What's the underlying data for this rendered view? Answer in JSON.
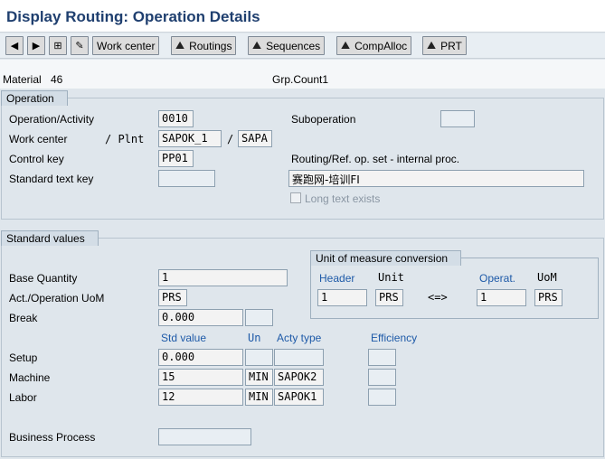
{
  "title": "Display Routing: Operation Details",
  "toolbar": {
    "work_center": "Work center",
    "routings": "Routings",
    "sequences": "Sequences",
    "compalloc": "CompAlloc",
    "prt": "PRT"
  },
  "header": {
    "material_label": "Material",
    "material_value": "46",
    "grpcount_label": "Grp.Count1"
  },
  "operation": {
    "section_title": "Operation",
    "op_activity_label": "Operation/Activity",
    "op_activity_value": "0010",
    "suboperation_label": "Suboperation",
    "suboperation_value": "",
    "work_center_label": "Work center",
    "plnt_label": "/ Plnt",
    "work_center_value": "SAPOK_1",
    "slash": "/",
    "plant_value": "SAPA",
    "control_key_label": "Control key",
    "control_key_value": "PP01",
    "routing_ref_label": "Routing/Ref. op. set - internal proc.",
    "standard_text_label": "Standard text key",
    "standard_text_value": "",
    "description_value": "赛跑网-培训FI",
    "long_text_label": "Long text exists"
  },
  "standard_values": {
    "section_title": "Standard values",
    "base_qty_label": "Base Quantity",
    "base_qty_value": "1",
    "act_uom_label": "Act./Operation UoM",
    "act_uom_value": "PRS",
    "break_label": "Break",
    "break_value": "0.000",
    "break_unit": "",
    "col_std_value": "Std value",
    "col_un": "Un",
    "col_acty_type": "Acty type",
    "col_efficiency": "Efficiency",
    "rows": [
      {
        "label": "Setup",
        "value": "0.000",
        "unit": "",
        "acty": "",
        "eff": ""
      },
      {
        "label": "Machine",
        "value": "15",
        "unit": "MIN",
        "acty": "SAPOK2",
        "eff": ""
      },
      {
        "label": "Labor",
        "value": "12",
        "unit": "MIN",
        "acty": "SAPOK1",
        "eff": ""
      }
    ],
    "business_process_label": "Business Process",
    "business_process_value": ""
  },
  "uom_conversion": {
    "title": "Unit of measure conversion",
    "header_label": "Header",
    "unit_label": "Unit",
    "operat_label": "Operat.",
    "uom_label": "UoM",
    "header_value": "1",
    "header_unit": "PRS",
    "arrow": "<=>",
    "operat_value": "1",
    "operat_uom": "PRS"
  }
}
